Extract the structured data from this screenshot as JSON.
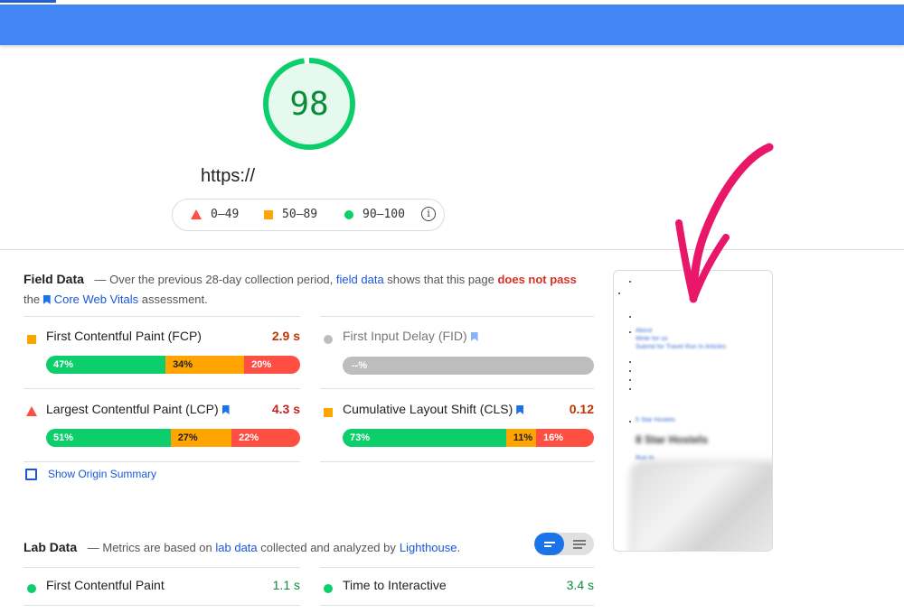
{
  "header": {
    "bar_color": "#4285f4"
  },
  "score": {
    "value": "98",
    "color": "#0cce6b",
    "fraction": 0.98
  },
  "url": "https://",
  "legend": {
    "items": [
      {
        "label": "0–49",
        "shape": "triangle",
        "color": "#ff4e42"
      },
      {
        "label": "50–89",
        "shape": "square",
        "color": "#ffa400"
      },
      {
        "label": "90–100",
        "shape": "circle",
        "color": "#0cce6b"
      }
    ],
    "info_icon": "info-icon"
  },
  "field_data": {
    "title": "Field Data",
    "desc_prefix": "— Over the previous 28-day collection period,",
    "desc_link": "field data",
    "desc_mid": "shows that this page",
    "desc_fail": "does not pass",
    "desc_the": "the",
    "desc_cwv": "Core Web Vitals",
    "desc_end": "assessment.",
    "metrics": {
      "fcp": {
        "name": "First Contentful Paint (FCP)",
        "value": "2.9 s",
        "dist": [
          "47%",
          "34%",
          "20%"
        ]
      },
      "fid": {
        "name": "First Input Delay (FID)",
        "value": "",
        "dist": [
          "--%"
        ]
      },
      "lcp": {
        "name": "Largest Contentful Paint (LCP)",
        "value": "4.3 s",
        "dist": [
          "51%",
          "27%",
          "22%"
        ]
      },
      "cls": {
        "name": "Cumulative Layout Shift (CLS)",
        "value": "0.12",
        "dist": [
          "73%",
          "11%",
          "16%"
        ]
      }
    },
    "origin_summary": "Show Origin Summary"
  },
  "lab_data": {
    "title": "Lab Data",
    "desc_prefix": "— Metrics are based on",
    "desc_link": "lab data",
    "desc_mid": "collected and analyzed by",
    "desc_link2": "Lighthouse",
    "desc_end": ".",
    "metrics": [
      {
        "name": "First Contentful Paint",
        "value": "1.1 s"
      },
      {
        "name": "Time to Interactive",
        "value": "3.4 s"
      }
    ]
  },
  "thumbnail": {
    "links": [
      "About",
      "Write for us",
      "Submit for Travel Run In Articles"
    ],
    "crumb": "5 Star Hostels",
    "heading": "8 Star Hostels",
    "byline": "Run In"
  },
  "colors": {
    "pass": "#0cce6b",
    "average": "#ffa400",
    "fail": "#ff4e42",
    "link": "#1a56db",
    "arrow": "#e8176a"
  }
}
